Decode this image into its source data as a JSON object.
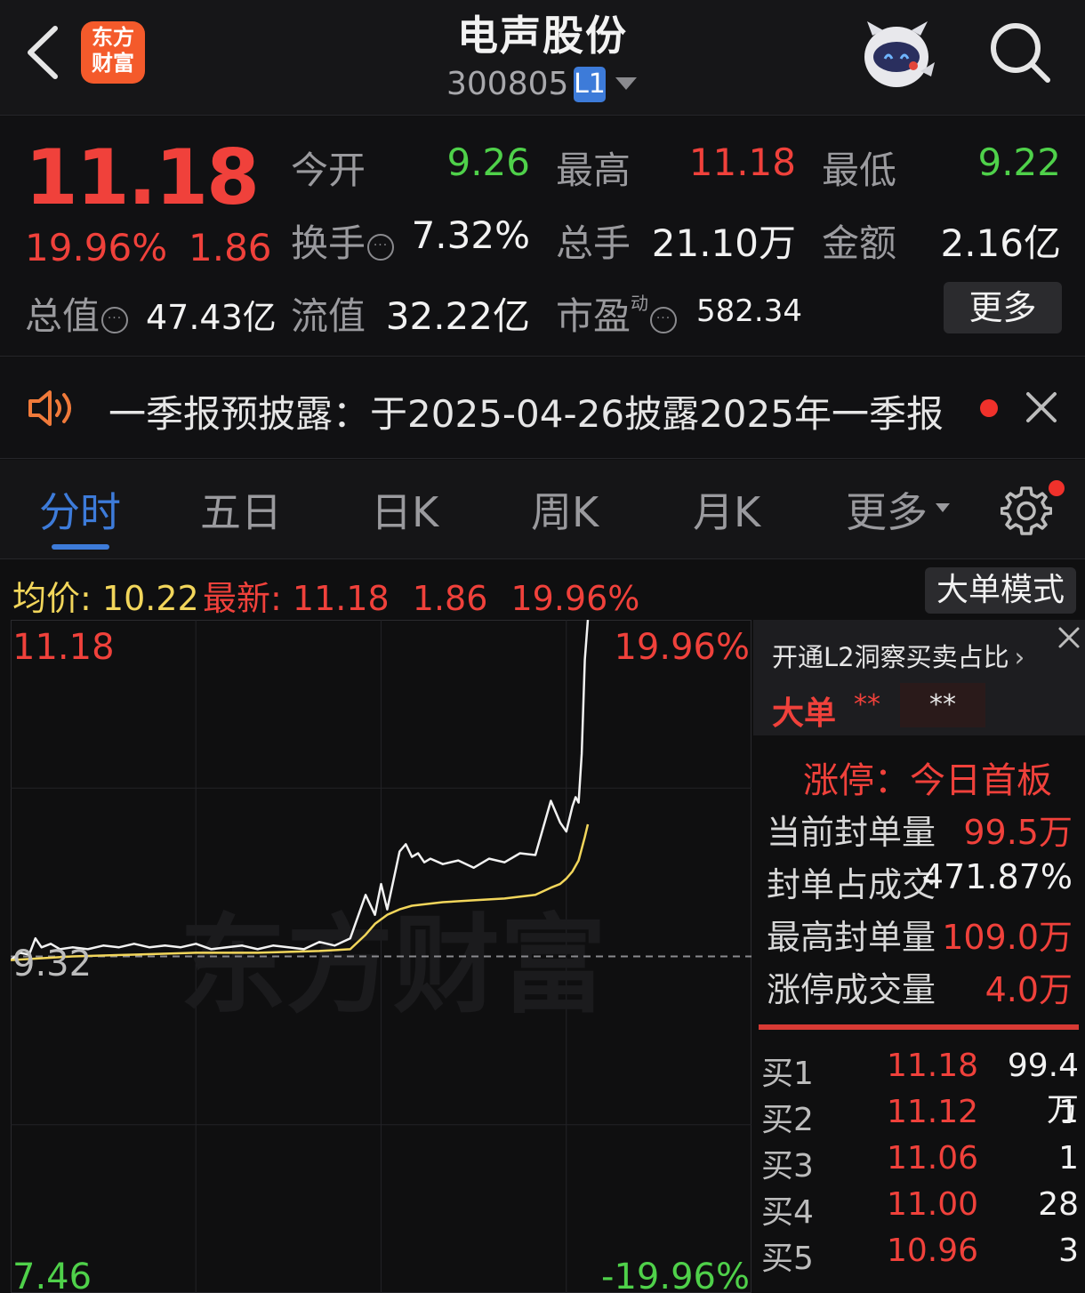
{
  "header": {
    "title": "电声股份",
    "code": "300805",
    "level_badge": "L1",
    "logo_text_line1": "东方",
    "logo_text_line2": "财富"
  },
  "quote": {
    "price": "11.18",
    "change_pct": "19.96%",
    "change": "1.86",
    "fields": {
      "open_label": "今开",
      "open_value": "9.26",
      "high_label": "最高",
      "high_value": "11.18",
      "low_label": "最低",
      "low_value": "9.22",
      "turnover_label": "换手",
      "turnover_value": "7.32%",
      "volume_label": "总手",
      "volume_value": "21.10万",
      "amount_label": "金额",
      "amount_value": "2.16亿",
      "mktcap_label": "总值",
      "mktcap_value": "47.43亿",
      "float_label": "流值",
      "float_value": "32.22亿",
      "pe_label": "市盈",
      "pe_superscript": "动",
      "pe_value": "582.34"
    },
    "more_button": "更多"
  },
  "notice": {
    "text": "一季报预披露：于2025-04-26披露2025年一季报"
  },
  "tabs": [
    {
      "label": "分时",
      "active": true
    },
    {
      "label": "五日",
      "active": false
    },
    {
      "label": "日K",
      "active": false
    },
    {
      "label": "周K",
      "active": false
    },
    {
      "label": "月K",
      "active": false
    },
    {
      "label": "更多",
      "active": false
    }
  ],
  "infobar": {
    "avg_label": "均价:",
    "avg_value": "10.22",
    "latest_label": "最新:",
    "latest_value": "11.18",
    "latest_change": "1.86",
    "latest_pct": "19.96%",
    "bigorder_button": "大单模式"
  },
  "chart_data": {
    "type": "line",
    "y_top_label": "11.18",
    "y_mid_label": "9.32",
    "y_bottom_label": "7.46",
    "pct_top_label": "19.96%",
    "pct_bottom_label": "-19.96%",
    "watermark": "东方财富",
    "ylim": [
      7.46,
      11.18
    ],
    "reference_price": 9.32,
    "series": [
      {
        "role": "price",
        "color": "#f2f2f2",
        "x": [
          0,
          3,
          6,
          8,
          10,
          13,
          16,
          20,
          25,
          30,
          35,
          40,
          45,
          50,
          55,
          60,
          65,
          70,
          75,
          80,
          85,
          90,
          95,
          100,
          105,
          110,
          115,
          118,
          120,
          122,
          124,
          126,
          128,
          130,
          132,
          134,
          136,
          140,
          145,
          150,
          155,
          160,
          165,
          170,
          175,
          178,
          180,
          182,
          183,
          184,
          185,
          186,
          187
        ],
        "y": [
          9.3,
          9.34,
          9.33,
          9.42,
          9.37,
          9.39,
          9.36,
          9.37,
          9.36,
          9.38,
          9.37,
          9.39,
          9.37,
          9.38,
          9.37,
          9.39,
          9.36,
          9.37,
          9.38,
          9.36,
          9.38,
          9.37,
          9.36,
          9.4,
          9.38,
          9.42,
          9.66,
          9.55,
          9.72,
          9.58,
          9.74,
          9.9,
          9.94,
          9.87,
          9.89,
          9.84,
          9.86,
          9.83,
          9.85,
          9.81,
          9.86,
          9.84,
          9.89,
          9.88,
          10.18,
          10.06,
          10.01,
          10.15,
          10.2,
          10.17,
          10.44,
          10.96,
          11.18
        ]
      },
      {
        "role": "average",
        "color": "#f2d65b",
        "x": [
          0,
          20,
          40,
          60,
          80,
          100,
          110,
          115,
          118,
          122,
          126,
          130,
          140,
          150,
          160,
          170,
          175,
          178,
          180,
          182,
          184,
          186,
          187
        ],
        "y": [
          9.3,
          9.32,
          9.33,
          9.34,
          9.34,
          9.35,
          9.36,
          9.44,
          9.5,
          9.55,
          9.58,
          9.6,
          9.62,
          9.63,
          9.64,
          9.66,
          9.7,
          9.72,
          9.75,
          9.79,
          9.85,
          9.98,
          10.05
        ]
      }
    ]
  },
  "right_panel": {
    "l2_title": "开通L2洞察买卖占比",
    "big_label": "大单",
    "big_stars1": "**",
    "big_stars2": "**",
    "limit_title": "涨停：今日首板",
    "rows": [
      {
        "label": "当前封单量",
        "value": "99.5万"
      },
      {
        "label": "封单占成交",
        "value": "471.87%"
      },
      {
        "label": "最高封单量",
        "value": "109.0万"
      },
      {
        "label": "涨停成交量",
        "value": "4.0万"
      }
    ],
    "orderbook": [
      {
        "label": "买1",
        "price": "11.18",
        "volume": "99.4万"
      },
      {
        "label": "买2",
        "price": "11.12",
        "volume": "1"
      },
      {
        "label": "买3",
        "price": "11.06",
        "volume": "1"
      },
      {
        "label": "买4",
        "price": "11.00",
        "volume": "28"
      },
      {
        "label": "买5",
        "price": "10.96",
        "volume": "3"
      }
    ]
  },
  "colors": {
    "up": "#f0413b",
    "down": "#4fd14a",
    "accent": "#3d7bd9",
    "avg_line": "#f2d65b"
  }
}
